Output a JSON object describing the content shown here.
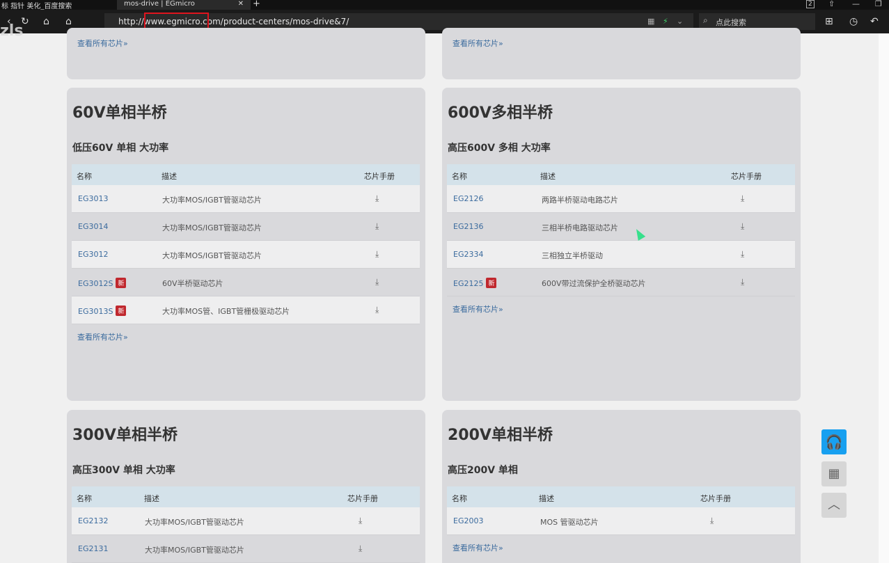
{
  "browser": {
    "left_text": "标 指针 美化_百度搜索",
    "tab_title": "mos-drive | EGmicro",
    "tab_close": "✕",
    "new_tab": "+",
    "url": "http://www.egmicro.com/product-centers/mos-drive&7/",
    "search_placeholder": "点此搜索",
    "counter": "2",
    "watermark": "zls"
  },
  "top_cards": [
    {
      "more": "查看所有芯片»"
    },
    {
      "more": "查看所有芯片»"
    }
  ],
  "cards": [
    {
      "title": "60V单相半桥",
      "subtitle": "低压60V 单相 大功率",
      "headers": {
        "name": "名称",
        "desc": "描述",
        "manual": "芯片手册"
      },
      "rows": [
        {
          "name": "EG3013",
          "desc": "大功率MOS/IGBT管驱动芯片",
          "badge": ""
        },
        {
          "name": "EG3014",
          "desc": "大功率MOS/IGBT管驱动芯片",
          "badge": ""
        },
        {
          "name": "EG3012",
          "desc": "大功率MOS/IGBT管驱动芯片",
          "badge": ""
        },
        {
          "name": "EG3012S",
          "desc": "60V半桥驱动芯片",
          "badge": "新"
        },
        {
          "name": "EG3013S",
          "desc": "大功率MOS管、IGBT管栅极驱动芯片",
          "badge": "新"
        }
      ],
      "more": "查看所有芯片»"
    },
    {
      "title": "600V多相半桥",
      "subtitle": "高压600V 多相 大功率",
      "headers": {
        "name": "名称",
        "desc": "描述",
        "manual": "芯片手册"
      },
      "rows": [
        {
          "name": "EG2126",
          "desc": "两路半桥驱动电路芯片",
          "badge": ""
        },
        {
          "name": "EG2136",
          "desc": "三相半桥电路驱动芯片",
          "badge": ""
        },
        {
          "name": "EG2334",
          "desc": "三相独立半桥驱动",
          "badge": ""
        },
        {
          "name": "EG2125",
          "desc": "600V带过流保护全桥驱动芯片",
          "badge": "新"
        }
      ],
      "more": "查看所有芯片»"
    },
    {
      "title": "300V单相半桥",
      "subtitle": "高压300V 单相 大功率",
      "headers": {
        "name": "名称",
        "desc": "描述",
        "manual": "芯片手册"
      },
      "rows": [
        {
          "name": "EG2132",
          "desc": "大功率MOS/IGBT管驱动芯片",
          "badge": ""
        },
        {
          "name": "EG2131",
          "desc": "大功率MOS/IGBT管驱动芯片",
          "badge": ""
        }
      ],
      "more": ""
    },
    {
      "title": "200V单相半桥",
      "subtitle": "高压200V 单相",
      "headers": {
        "name": "名称",
        "desc": "描述",
        "manual": "芯片手册"
      },
      "rows": [
        {
          "name": "EG2003",
          "desc": "MOS 管驱动芯片",
          "badge": ""
        }
      ],
      "more": "查看所有芯片»"
    }
  ],
  "colors": {
    "accent": "#18a0f0",
    "badge": "#c0282e",
    "link": "#3b6b9e",
    "highlight": "#e0141e"
  }
}
